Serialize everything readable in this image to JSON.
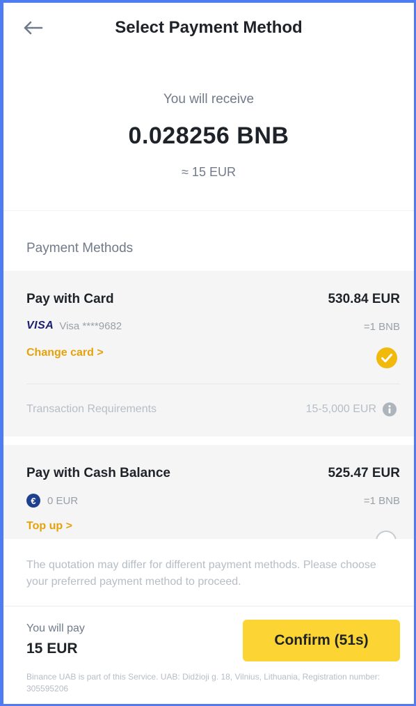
{
  "header": {
    "title": "Select Payment Method",
    "back_icon": "arrow-left-icon"
  },
  "receive": {
    "label": "You will receive",
    "amount": "0.028256 BNB",
    "fiat_equivalent": "≈ 15 EUR"
  },
  "payment_methods": {
    "heading": "Payment Methods",
    "card": {
      "name": "Pay with Card",
      "amount": "530.84 EUR",
      "brand_logo": "VISA",
      "card_label": "Visa ****9682",
      "rate": "=1 BNB",
      "change_link": "Change card >",
      "selected": true,
      "requirements_label": "Transaction Requirements",
      "requirements_value": "15-5,000 EUR"
    },
    "cash": {
      "name": "Pay with Cash Balance",
      "amount": "525.47 EUR",
      "balance": "0 EUR",
      "balance_symbol": "€",
      "rate": "=1 BNB",
      "topup_link": "Top up >",
      "selected": false
    }
  },
  "disclaimer": "The quotation may differ for different payment methods. Please choose your preferred payment method to proceed.",
  "footer": {
    "pay_label": "You will pay",
    "pay_amount": "15 EUR",
    "confirm_label": "Confirm (51s)",
    "legal": "Binance UAB is part of this Service. UAB: Didžioji g. 18, Vilnius, Lithuania, Registration number: 305595206"
  },
  "colors": {
    "accent": "#fcd535",
    "link": "#e6a20a",
    "frame": "#4f7cf0"
  }
}
